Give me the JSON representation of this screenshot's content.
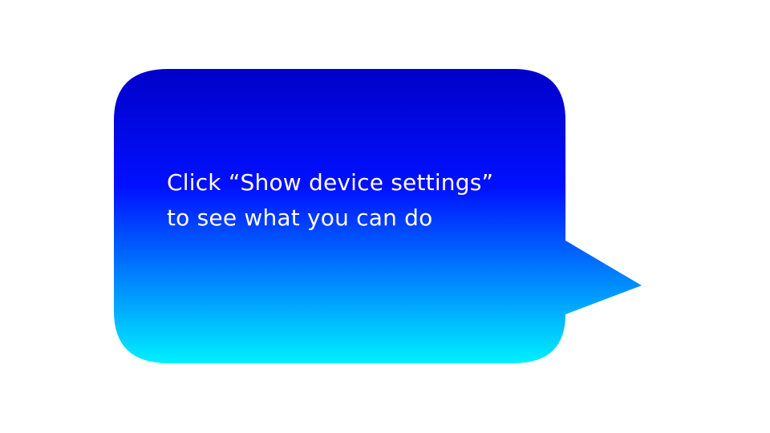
{
  "callout": {
    "line1": "Click “Show device settings”",
    "line2": "to see what you can do",
    "gradient_top": "#0000c8",
    "gradient_mid": "#0010ff",
    "gradient_bottom": "#00f0ff",
    "text_color": "#ffffff"
  }
}
